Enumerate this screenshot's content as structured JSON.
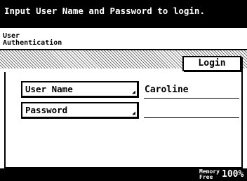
{
  "header": {
    "title": "Input User Name and Password to login."
  },
  "section": {
    "label_line1": "User",
    "label_line2": "Authentication"
  },
  "buttons": {
    "login": "Login"
  },
  "fields": [
    {
      "label": "User Name",
      "value": "Caroline"
    },
    {
      "label": "Password",
      "value": ""
    }
  ],
  "status": {
    "memory_label_line1": "Memory",
    "memory_label_line2": "Free",
    "memory_value": "100%"
  }
}
